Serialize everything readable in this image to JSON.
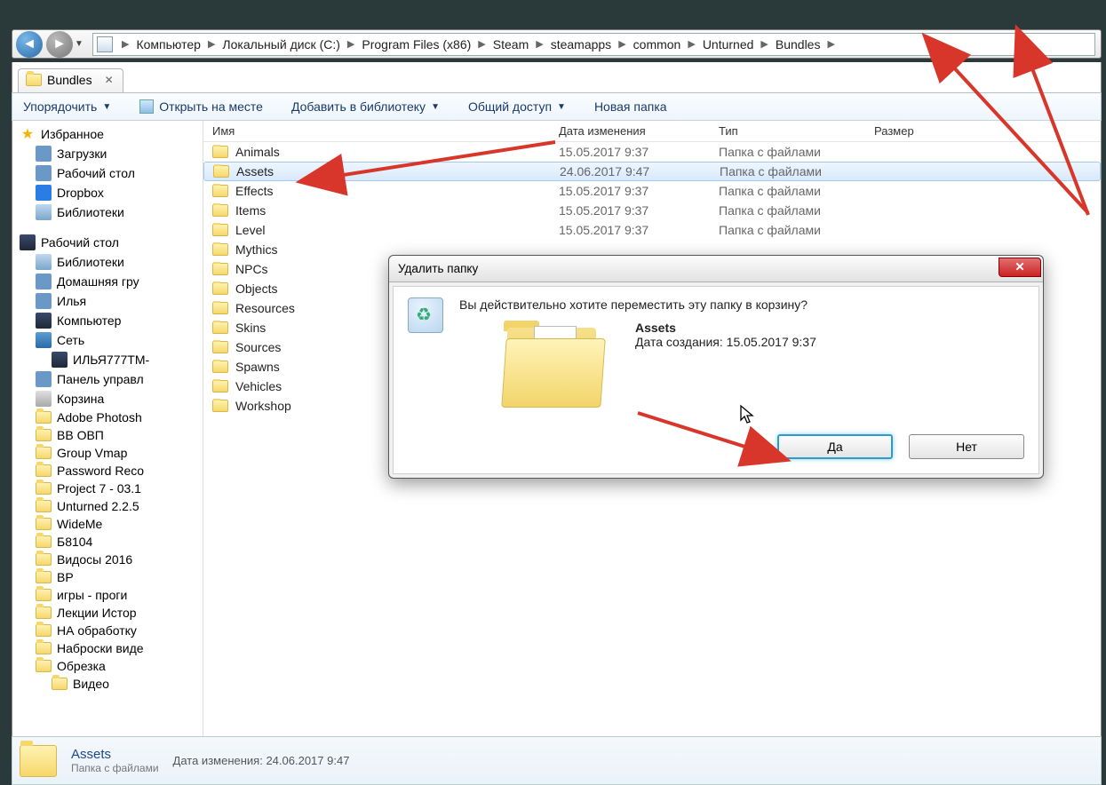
{
  "breadcrumb": [
    "Компьютер",
    "Локальный диск (C:)",
    "Program Files (x86)",
    "Steam",
    "steamapps",
    "common",
    "Unturned",
    "Bundles"
  ],
  "tab": {
    "label": "Bundles"
  },
  "toolbar": {
    "organize": "Упорядочить",
    "open": "Открыть на месте",
    "addlib": "Добавить в библиотеку",
    "share": "Общий доступ",
    "newfolder": "Новая папка"
  },
  "columns": {
    "name": "Имя",
    "date": "Дата изменения",
    "type": "Тип",
    "size": "Размер"
  },
  "sidebar": {
    "fav": "Избранное",
    "fav_items": [
      "Загрузки",
      "Рабочий стол",
      "Dropbox",
      "Библиотеки"
    ],
    "desktop": "Рабочий стол",
    "desktop_items": [
      "Библиотеки",
      "Домашняя гру",
      "Илья",
      "Компьютер",
      "Сеть",
      "ИЛЬЯ777ТМ-",
      "Панель управл",
      "Корзина",
      "Adobe Photosh",
      "BB ОВП",
      "Group Vmap",
      "Password Reco",
      "Project 7 - 03.1",
      "Unturned 2.2.5",
      "WideMe",
      "Б8104",
      "Видосы 2016",
      "ВР",
      "игры - проги",
      "Лекции Истор",
      "НА обработку",
      "Наброски виде",
      "Обрезка",
      "Видео"
    ]
  },
  "files": [
    {
      "name": "Animals",
      "date": "15.05.2017 9:37",
      "type": "Папка с файлами"
    },
    {
      "name": "Assets",
      "date": "24.06.2017 9:47",
      "type": "Папка с файлами",
      "selected": true
    },
    {
      "name": "Effects",
      "date": "15.05.2017 9:37",
      "type": "Папка с файлами"
    },
    {
      "name": "Items",
      "date": "15.05.2017 9:37",
      "type": "Папка с файлами"
    },
    {
      "name": "Level",
      "date": "15.05.2017 9:37",
      "type": "Папка с файлами"
    },
    {
      "name": "Mythics",
      "date": "",
      "type": ""
    },
    {
      "name": "NPCs",
      "date": "",
      "type": ""
    },
    {
      "name": "Objects",
      "date": "",
      "type": ""
    },
    {
      "name": "Resources",
      "date": "",
      "type": ""
    },
    {
      "name": "Skins",
      "date": "",
      "type": ""
    },
    {
      "name": "Sources",
      "date": "",
      "type": ""
    },
    {
      "name": "Spawns",
      "date": "",
      "type": ""
    },
    {
      "name": "Vehicles",
      "date": "",
      "type": ""
    },
    {
      "name": "Workshop",
      "date": "",
      "type": ""
    }
  ],
  "details": {
    "name": "Assets",
    "type": "Папка с файлами",
    "date_label": "Дата изменения:",
    "date": "24.06.2017 9:47"
  },
  "dialog": {
    "title": "Удалить папку",
    "message": "Вы действительно хотите переместить эту папку в корзину?",
    "item_name": "Assets",
    "created_label": "Дата создания:",
    "created": "15.05.2017 9:37",
    "yes": "Да",
    "no": "Нет"
  }
}
